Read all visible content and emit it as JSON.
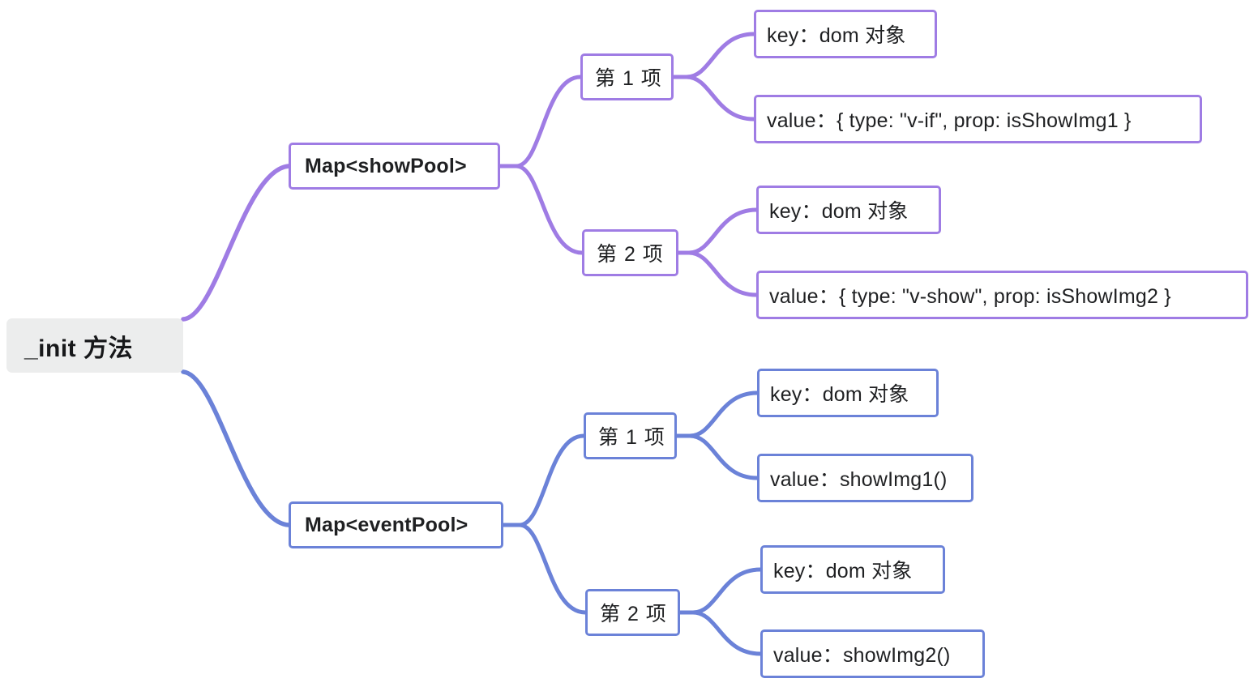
{
  "diagram": {
    "type": "mindmap",
    "title": "_init 方法",
    "colors": {
      "purple_branch": "#9f7ce4",
      "blue_branch": "#6b82d8",
      "root_background": "#eceded",
      "node_background": "#ffffff",
      "text": "#1f2022",
      "canvas_background": "#ffffff"
    }
  },
  "root": {
    "label": "_init 方法"
  },
  "branches": [
    {
      "label": "Map<showPool>",
      "color": "#9f7ce4",
      "items": [
        {
          "label": "第 1 项",
          "key": "key：dom 对象",
          "value": "value：{ type: \"v-if\", prop: isShowImg1 }"
        },
        {
          "label": "第 2 项",
          "key": "key：dom 对象",
          "value": "value：{ type: \"v-show\", prop: isShowImg2 }"
        }
      ]
    },
    {
      "label": "Map<eventPool>",
      "color": "#6b82d8",
      "items": [
        {
          "label": "第 1 项",
          "key": "key：dom 对象",
          "value": "value：showImg1()"
        },
        {
          "label": "第 2 项",
          "key": "key：dom 对象",
          "value": "value：showImg2()"
        }
      ]
    }
  ]
}
